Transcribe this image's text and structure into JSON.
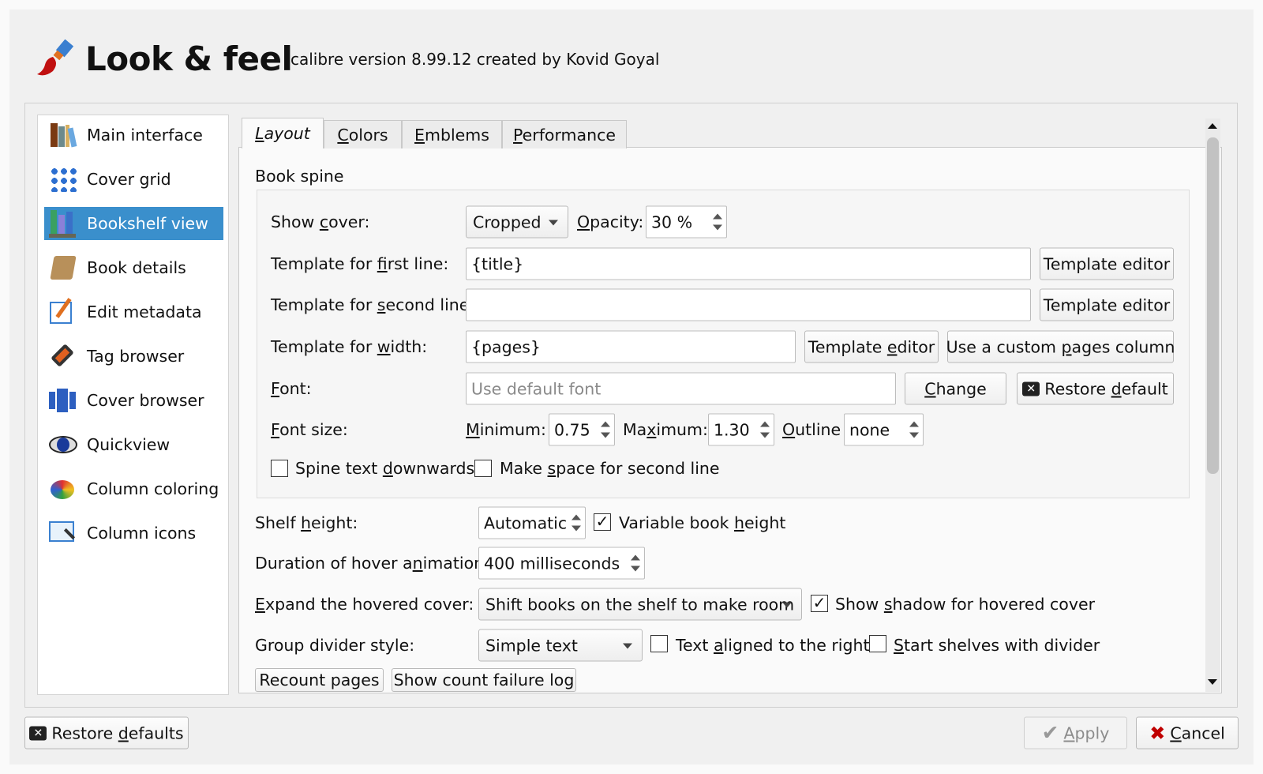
{
  "header": {
    "title": "Look & feel",
    "subtitle": "calibre version 8.99.12 created by Kovid Goyal"
  },
  "sidebar": {
    "items": [
      {
        "label": "Main interface",
        "icon": "books-icon"
      },
      {
        "label": "Cover grid",
        "icon": "grid-icon"
      },
      {
        "label": "Bookshelf view",
        "icon": "bookshelf-icon",
        "selected": true
      },
      {
        "label": "Book details",
        "icon": "book-icon"
      },
      {
        "label": "Edit metadata",
        "icon": "edit-icon"
      },
      {
        "label": "Tag browser",
        "icon": "tag-icon"
      },
      {
        "label": "Cover browser",
        "icon": "cover-browser-icon"
      },
      {
        "label": "Quickview",
        "icon": "eye-icon"
      },
      {
        "label": "Column coloring",
        "icon": "palette-icon"
      },
      {
        "label": "Column icons",
        "icon": "image-icon"
      }
    ]
  },
  "tabs": [
    "Layout",
    "Colors",
    "Emblems",
    "Performance"
  ],
  "book_spine": {
    "title": "Book spine",
    "show_cover_label": "Show cover:",
    "show_cover_value": "Cropped",
    "opacity_label": "Opacity:",
    "opacity_value": "30 %",
    "first_line_label": "Template for first line:",
    "first_line_value": "{title}",
    "second_line_label": "Template for second line:",
    "second_line_value": "",
    "width_label": "Template for width:",
    "width_value": "{pages}",
    "template_editor": "Template editor",
    "custom_pages": "Use a custom pages column",
    "font_label": "Font:",
    "font_placeholder": "Use default font",
    "change": "Change",
    "restore_default": "Restore default",
    "font_size_label": "Font size:",
    "minimum_label": "Minimum:",
    "minimum_value": "0.75",
    "maximum_label": "Maximum:",
    "maximum_value": "1.30",
    "outline_label": "Outline",
    "outline_value": "none",
    "spine_down": "Spine text downwards",
    "spine_down_checked": false,
    "second_line_space": "Make space for second line",
    "second_line_space_checked": false
  },
  "shelf": {
    "height_label": "Shelf height:",
    "height_value": "Automatic",
    "variable_height": "Variable book height",
    "variable_height_checked": true,
    "duration_label": "Duration of hover animation:",
    "duration_value": "400 milliseconds",
    "expand_label": "Expand the hovered cover:",
    "expand_value": "Shift books on the shelf to make room",
    "shadow": "Show shadow for hovered cover",
    "shadow_checked": true,
    "divider_label": "Group divider style:",
    "divider_value": "Simple text",
    "aligned_right": "Text aligned to the right",
    "aligned_right_checked": false,
    "start_divider": "Start shelves with divider",
    "start_divider_checked": false,
    "recount": "Recount pages",
    "failure_log": "Show count failure log"
  },
  "footer": {
    "restore_defaults": "Restore defaults",
    "apply": "Apply",
    "cancel": "Cancel"
  },
  "colors": {
    "accent": "#3a8fcc",
    "cancel_x": "#c00000"
  }
}
